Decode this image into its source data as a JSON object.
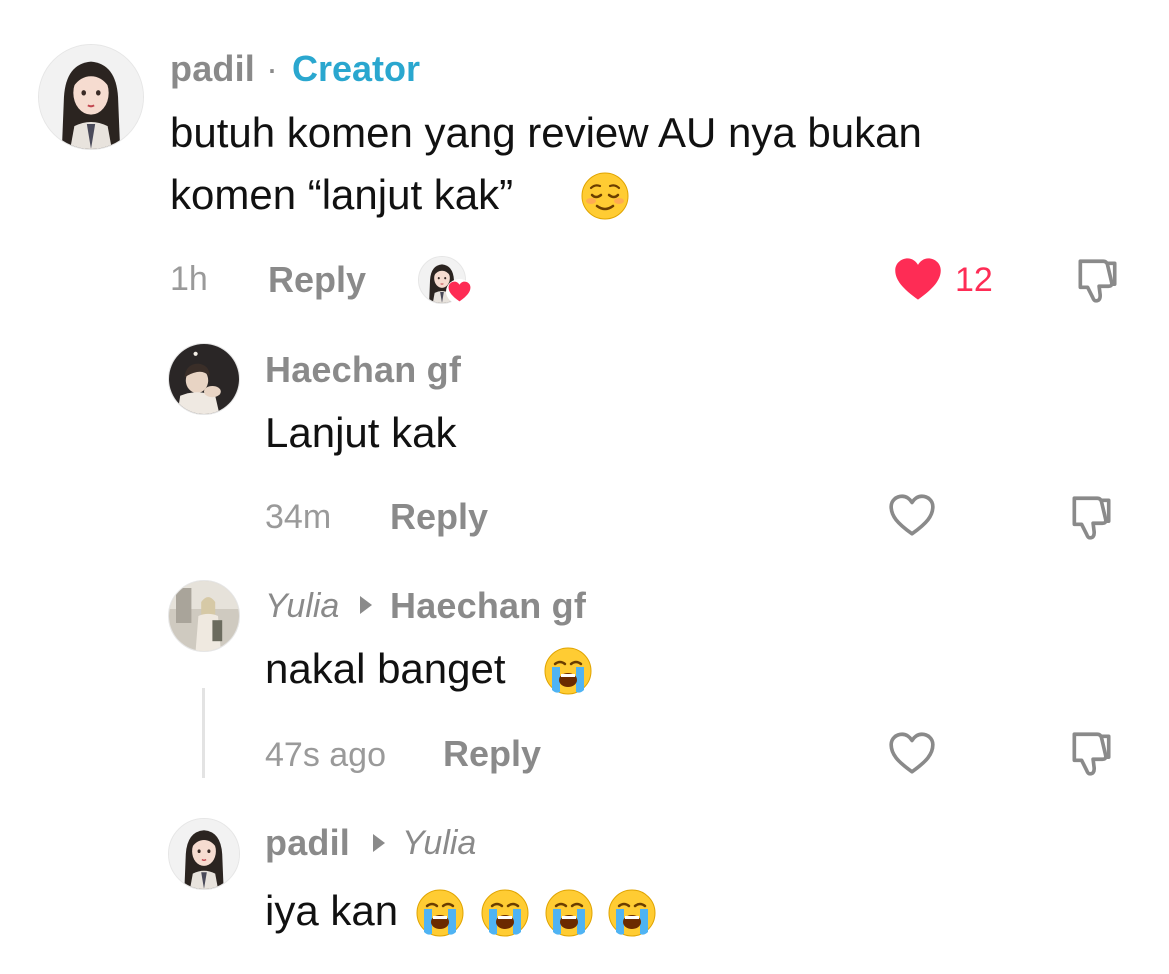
{
  "comments": [
    {
      "username": "padil",
      "separator": "·",
      "badge": "Creator",
      "text_line1": "butuh komen yang review AU nya bukan",
      "text_line2": "komen “lanjut kak”",
      "emoji": "relieved-face-emoji",
      "time": "1h",
      "reply_label": "Reply",
      "liked_by_creator": true,
      "liked": true,
      "like_count": "12"
    },
    {
      "username": "Haechan gf",
      "text": "Lanjut kak",
      "time": "34m",
      "reply_label": "Reply",
      "liked": false
    },
    {
      "username": "Yulia",
      "reply_to": "Haechan gf",
      "text": "nakal banget",
      "emoji": "loudly-crying-face-emoji",
      "time": "47s ago",
      "reply_label": "Reply",
      "liked": false
    },
    {
      "username": "padil",
      "reply_to": "Yulia",
      "text": "iya kan",
      "emojis": [
        "loudly-crying-face-emoji",
        "loudly-crying-face-emoji",
        "loudly-crying-face-emoji",
        "loudly-crying-face-emoji"
      ]
    }
  ],
  "colors": {
    "accent_like": "#fe2c55",
    "creator_badge": "#2aa7cf",
    "muted_text": "#8a8a8a"
  },
  "icons": {
    "heart_filled": "heart-filled-icon",
    "heart_outline": "heart-outline-icon",
    "dislike": "thumbs-down-icon"
  }
}
